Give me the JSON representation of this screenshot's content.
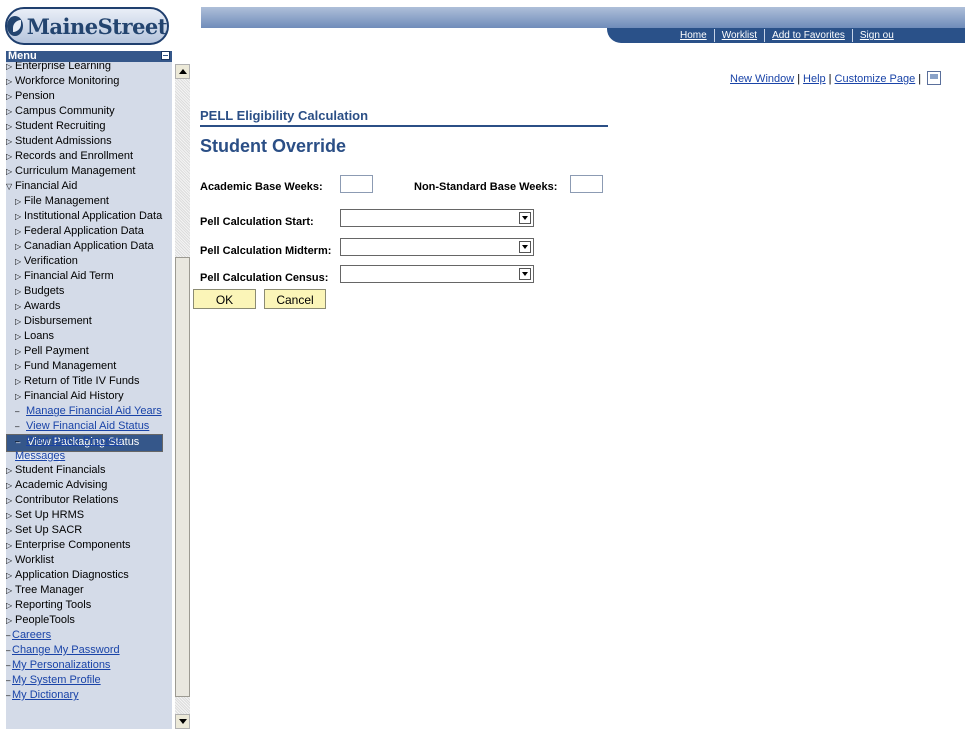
{
  "logo": {
    "text": "MaineStreet"
  },
  "nav": {
    "links": [
      "Home",
      "Worklist",
      "Add to Favorites",
      "Sign ou"
    ]
  },
  "menu": {
    "title": "Menu",
    "items": [
      {
        "label": "Enterprise Learning",
        "kind": "folder"
      },
      {
        "label": "Workforce Monitoring",
        "kind": "folder"
      },
      {
        "label": "Pension",
        "kind": "folder"
      },
      {
        "label": "Campus Community",
        "kind": "folder"
      },
      {
        "label": "Student Recruiting",
        "kind": "folder"
      },
      {
        "label": "Student Admissions",
        "kind": "folder"
      },
      {
        "label": "Records and Enrollment",
        "kind": "folder"
      },
      {
        "label": "Curriculum Management",
        "kind": "folder"
      },
      {
        "label": "Financial Aid",
        "kind": "open-folder"
      },
      {
        "label": "File Management",
        "kind": "subfolder"
      },
      {
        "label": "Institutional Application Data",
        "kind": "subfolder"
      },
      {
        "label": "Federal Application Data",
        "kind": "subfolder"
      },
      {
        "label": "Canadian Application Data",
        "kind": "subfolder"
      },
      {
        "label": "Verification",
        "kind": "subfolder"
      },
      {
        "label": "Financial Aid Term",
        "kind": "subfolder"
      },
      {
        "label": "Budgets",
        "kind": "subfolder"
      },
      {
        "label": "Awards",
        "kind": "subfolder"
      },
      {
        "label": "Disbursement",
        "kind": "subfolder"
      },
      {
        "label": "Loans",
        "kind": "subfolder"
      },
      {
        "label": "Pell Payment",
        "kind": "subfolder"
      },
      {
        "label": "Fund Management",
        "kind": "subfolder"
      },
      {
        "label": "Return of Title IV Funds",
        "kind": "subfolder"
      },
      {
        "label": "Financial Aid History",
        "kind": "subfolder"
      },
      {
        "label": "Manage Financial Aid Years",
        "kind": "sublink"
      },
      {
        "label": "View Financial Aid Status",
        "kind": "sublink"
      },
      {
        "label": "View Packaging Status Summary",
        "kind": "sublink-selected"
      },
      {
        "label": "Print Batch Process Messages",
        "kind": "sublink"
      },
      {
        "label": "Student Financials",
        "kind": "folder"
      },
      {
        "label": "Academic Advising",
        "kind": "folder"
      },
      {
        "label": "Contributor Relations",
        "kind": "folder"
      },
      {
        "label": "Set Up HRMS",
        "kind": "folder"
      },
      {
        "label": "Set Up SACR",
        "kind": "folder"
      },
      {
        "label": "Enterprise Components",
        "kind": "folder"
      },
      {
        "label": "Worklist",
        "kind": "folder"
      },
      {
        "label": "Application Diagnostics",
        "kind": "folder"
      },
      {
        "label": "Tree Manager",
        "kind": "folder"
      },
      {
        "label": "Reporting Tools",
        "kind": "folder"
      },
      {
        "label": "PeopleTools",
        "kind": "folder"
      },
      {
        "label": "Careers",
        "kind": "link"
      },
      {
        "label": "Change My Password",
        "kind": "link"
      },
      {
        "label": "My Personalizations",
        "kind": "link"
      },
      {
        "label": "My System Profile",
        "kind": "link"
      },
      {
        "label": "My Dictionary",
        "kind": "link"
      }
    ]
  },
  "toplinks": {
    "new_window": "New Window",
    "help": "Help",
    "customize": "Customize Page",
    "sep": "|"
  },
  "page": {
    "title": "PELL Eligibility Calculation",
    "subtitle": "Student Override"
  },
  "form": {
    "academic_base_weeks_label": "Academic Base Weeks:",
    "academic_base_weeks_value": "",
    "non_standard_base_weeks_label": "Non-Standard Base Weeks:",
    "non_standard_base_weeks_value": "",
    "pell_start_label": "Pell Calculation Start:",
    "pell_start_value": "",
    "pell_midterm_label": "Pell Calculation Midterm:",
    "pell_midterm_value": "",
    "pell_census_label": "Pell Calculation Census:",
    "pell_census_value": "",
    "ok_label": "OK",
    "cancel_label": "Cancel"
  },
  "colors": {
    "menu_bg": "#d4dbe8",
    "menu_selected": "#35578a",
    "title_blue": "#2b4f86",
    "button_yellow": "#fbf5b8",
    "link_blue": "#1a44a8"
  },
  "icons": {
    "http": "http-page-icon",
    "collapse": "collapse-menu-icon"
  }
}
